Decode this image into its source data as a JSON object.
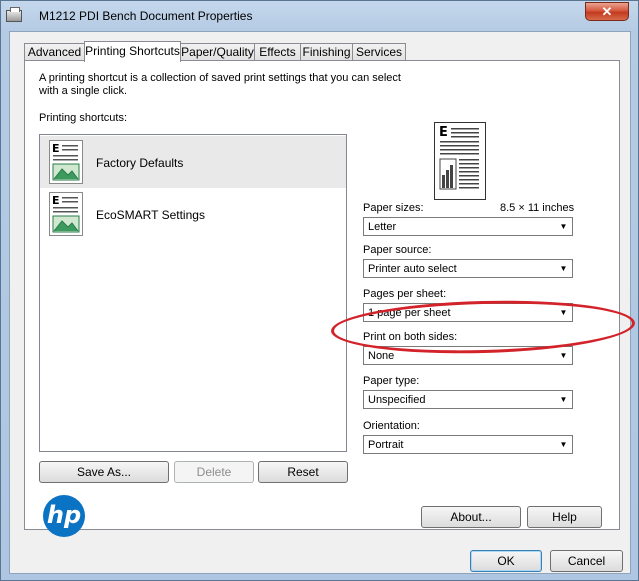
{
  "window": {
    "title": "M1212 PDI Bench Document Properties",
    "close_glyph": "✕"
  },
  "tabs": [
    {
      "label": "Advanced",
      "active": false
    },
    {
      "label": "Printing Shortcuts",
      "active": true
    },
    {
      "label": "Paper/Quality",
      "active": false
    },
    {
      "label": "Effects",
      "active": false
    },
    {
      "label": "Finishing",
      "active": false
    },
    {
      "label": "Services",
      "active": false
    }
  ],
  "shortcuts_page": {
    "description": "A printing shortcut is a collection of saved print settings that you can select with a single click.",
    "list_label": "Printing shortcuts:",
    "items": [
      {
        "name": "Factory Defaults",
        "selected": true
      },
      {
        "name": "EcoSMART Settings",
        "selected": false
      }
    ],
    "buttons": {
      "save_as": "Save As...",
      "delete": "Delete",
      "reset": "Reset"
    }
  },
  "settings": {
    "paper_sizes": {
      "label": "Paper sizes:",
      "dimensions": "8.5 × 11 inches",
      "value": "Letter"
    },
    "paper_source": {
      "label": "Paper source:",
      "value": "Printer auto select"
    },
    "pages_per_sheet": {
      "label": "Pages per sheet:",
      "value": "1 page per sheet"
    },
    "print_both_sides": {
      "label": "Print on both sides:",
      "value": "None"
    },
    "paper_type": {
      "label": "Paper type:",
      "value": "Unspecified"
    },
    "orientation": {
      "label": "Orientation:",
      "value": "Portrait"
    }
  },
  "brand": {
    "logo_text": "hp",
    "color": "#0b73c4"
  },
  "footer_buttons": {
    "about": "About...",
    "help": "Help",
    "ok": "OK",
    "cancel": "Cancel"
  },
  "annotation": {
    "color": "#d2232a",
    "target": "paper-source"
  }
}
